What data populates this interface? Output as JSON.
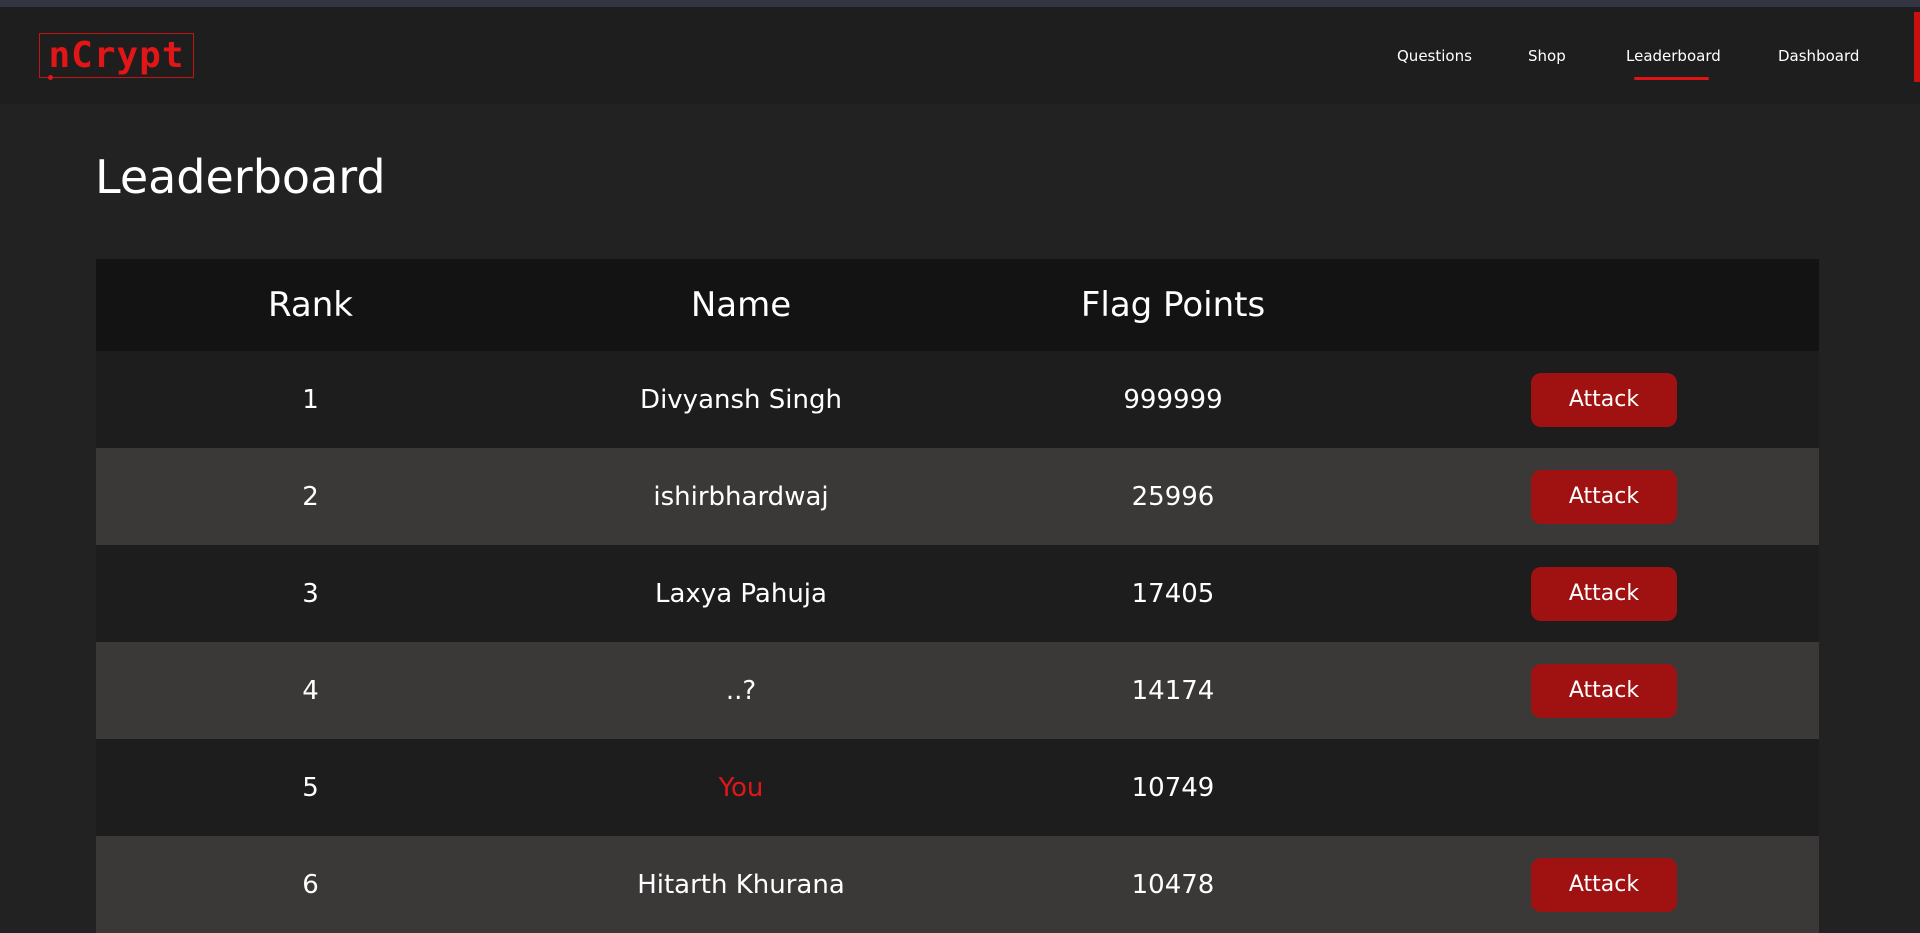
{
  "brand": {
    "logo_text": "nCrypt",
    "accent_color": "#e21616"
  },
  "nav": {
    "links": [
      {
        "label": "Questions",
        "active": false
      },
      {
        "label": "Shop",
        "active": false
      },
      {
        "label": "Leaderboard",
        "active": true
      },
      {
        "label": "Dashboard",
        "active": false
      }
    ]
  },
  "page": {
    "title": "Leaderboard"
  },
  "table": {
    "headers": [
      "Rank",
      "Name",
      "Flag Points",
      ""
    ],
    "rows": [
      {
        "rank": "1",
        "name": "Divyansh Singh",
        "points": "999999",
        "action": "Attack",
        "is_you": false
      },
      {
        "rank": "2",
        "name": "ishirbhardwaj",
        "points": "25996",
        "action": "Attack",
        "is_you": false
      },
      {
        "rank": "3",
        "name": "Laxya Pahuja",
        "points": "17405",
        "action": "Attack",
        "is_you": false
      },
      {
        "rank": "4",
        "name": "..?",
        "points": "14174",
        "action": "Attack",
        "is_you": false
      },
      {
        "rank": "5",
        "name": "You",
        "points": "10749",
        "action": "",
        "is_you": true
      },
      {
        "rank": "6",
        "name": "Hitarth Khurana",
        "points": "10478",
        "action": "Attack",
        "is_you": false
      }
    ]
  },
  "colors": {
    "background": "#222222",
    "navbar": "#1e1e1e",
    "table_header": "#131313",
    "row_odd": "#1d1d1d",
    "row_even": "#3b3838",
    "button": "#a01212",
    "highlight_you": "#e0161b"
  }
}
